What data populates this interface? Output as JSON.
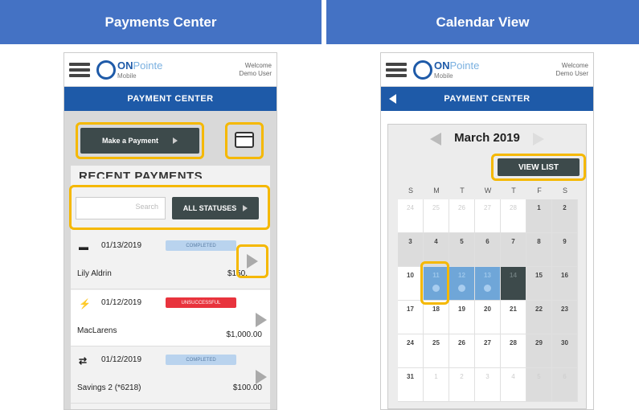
{
  "left_header": "Payments Center",
  "right_header": "Calendar View",
  "app": {
    "logo_on": "ON",
    "logo_pointe": "Pointe",
    "logo_mobile": "Mobile",
    "welcome_line1": "Welcome",
    "welcome_line2": "Demo User",
    "page_title": "PAYMENT CENTER"
  },
  "payments": {
    "make_payment_label": "Make a Payment",
    "recent_title": "RECENT PAYMENTS",
    "search_placeholder": "Search",
    "status_filter_label": "ALL STATUSES",
    "rows": [
      {
        "icon": "ach-icon",
        "glyph": "▬",
        "date": "01/13/2019",
        "status": "COMPLETED",
        "name": "Lily Aldrin",
        "amount": "$150."
      },
      {
        "icon": "lightning-icon",
        "glyph": "⚡",
        "date": "01/12/2019",
        "status": "UNSUCCESSFUL",
        "name": "MacLarens",
        "amount": "$1,000.00"
      },
      {
        "icon": "transfer-icon",
        "glyph": "⇄",
        "date": "01/12/2019",
        "status": "COMPLETED",
        "name": "Savings 2 (*6218)",
        "amount": "$100.00"
      }
    ]
  },
  "calendar": {
    "month_label": "March 2019",
    "view_list_label": "VIEW LIST",
    "weekdays": [
      "S",
      "M",
      "T",
      "W",
      "T",
      "F",
      "S"
    ],
    "weeks": [
      [
        "24",
        "25",
        "26",
        "27",
        "28",
        "1",
        "2"
      ],
      [
        "3",
        "4",
        "5",
        "6",
        "7",
        "8",
        "9"
      ],
      [
        "10",
        "11",
        "12",
        "13",
        "14",
        "15",
        "16"
      ],
      [
        "17",
        "18",
        "19",
        "20",
        "21",
        "22",
        "23"
      ],
      [
        "24",
        "25",
        "26",
        "27",
        "28",
        "29",
        "30"
      ],
      [
        "31",
        "1",
        "2",
        "3",
        "4",
        "5",
        "6"
      ]
    ]
  },
  "colors": {
    "header_blue": "#4472c4",
    "app_bar_blue": "#1e5aa8",
    "highlight": "#f5b800",
    "dark_button": "#3d4a4b",
    "completed_badge": "#b9d3ee",
    "unsuccessful_badge": "#e8333d"
  }
}
